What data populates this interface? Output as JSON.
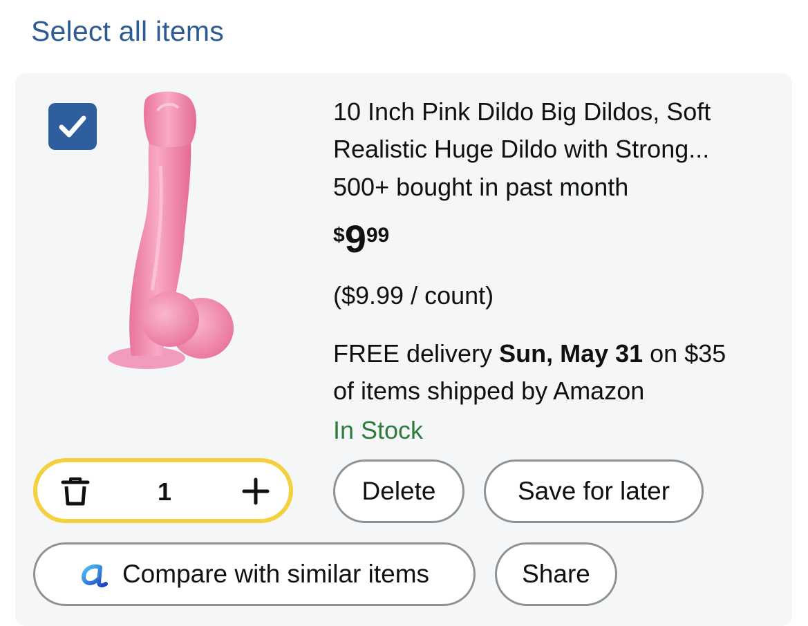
{
  "header": {
    "select_all": "Select all items"
  },
  "item": {
    "selected": true,
    "title_line1": "10 Inch Pink Dildo Big Dildos, Soft",
    "title_line2": "Realistic Huge Dildo with Strong...",
    "bought": "500+ bought in past month",
    "price": {
      "symbol": "$",
      "whole": "9",
      "fraction": "99"
    },
    "unit_price": "($9.99 / count)",
    "delivery": {
      "prefix": "FREE delivery ",
      "date": "Sun, May 31",
      "suffix_line1": " on $35",
      "line2": "of items shipped by Amazon"
    },
    "stock": "In Stock",
    "quantity": "1"
  },
  "actions": {
    "delete": "Delete",
    "save_for_later": "Save for later",
    "compare": "Compare with similar items",
    "share": "Share"
  },
  "colors": {
    "link_blue": "#2e5a94",
    "checkbox_blue": "#2f5e9e",
    "stock_green": "#2f7a3c",
    "quantity_border": "#f3d03e",
    "card_background": "#f5f6f7"
  },
  "icons": {
    "checkbox": "checkmark-icon",
    "quantity_decrement": "trash-icon",
    "quantity_increment": "plus-icon",
    "compare": "compare-a-icon"
  }
}
